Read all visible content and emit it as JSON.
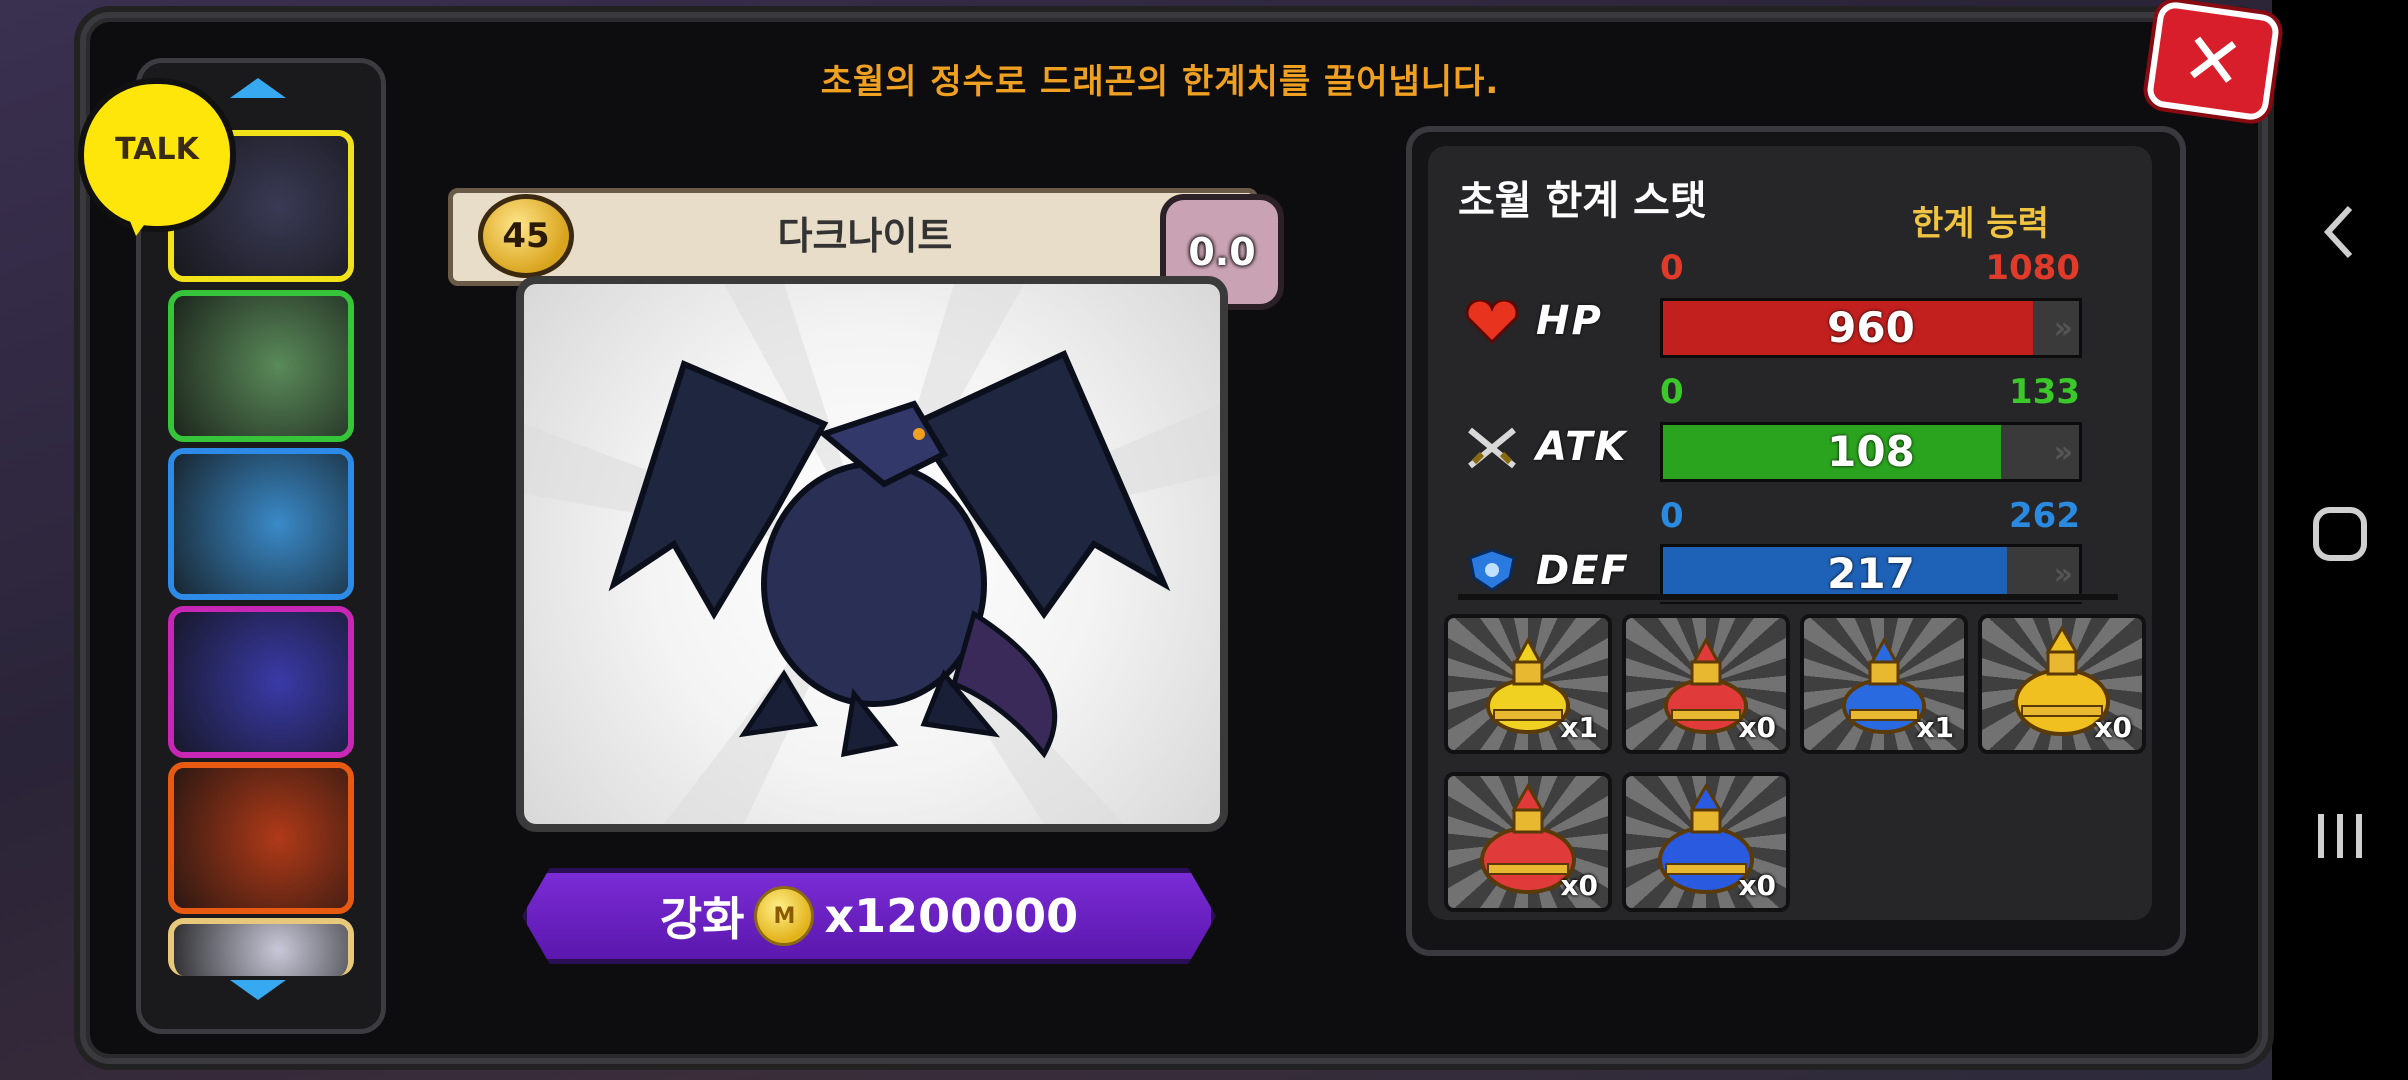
{
  "header": {
    "headline": "초월의 정수로 드래곤의 한계치를 끌어냅니다."
  },
  "close_icon": "close-icon",
  "talk_badge": {
    "label": "TALK"
  },
  "dragon_list": {
    "items": [
      {
        "name": "dark-dragon",
        "border": "#f2e21a",
        "bg": "#3a3a55"
      },
      {
        "name": "pink-dragon",
        "border": "#35c43a",
        "bg": "#5a8a5a"
      },
      {
        "name": "ice-dragon",
        "border": "#2d8ae6",
        "bg": "#3a8ac8"
      },
      {
        "name": "blue-red-dragon",
        "border": "#c826b4",
        "bg": "#3a3aa8"
      },
      {
        "name": "fire-dragon",
        "border": "#e85a12",
        "bg": "#b03a18"
      },
      {
        "name": "white-dragon",
        "border": "#e8c87a",
        "bg": "#c8c8d8"
      }
    ]
  },
  "card": {
    "level": "45",
    "name": "다크나이트",
    "star": "0.0"
  },
  "upgrade": {
    "label": "강화",
    "coin": "M",
    "cost": "x1200000"
  },
  "stats_panel": {
    "title": "초월 한계 스탯",
    "limit_label": "한계 능력",
    "stats": [
      {
        "name": "HP",
        "min": "0",
        "max": "1080",
        "value": "960",
        "fraction": 0.889,
        "color": "#c2201e",
        "label_color": "#e03a2a"
      },
      {
        "name": "ATK",
        "min": "0",
        "max": "133",
        "value": "108",
        "fraction": 0.812,
        "color": "#2aa41e",
        "label_color": "#3ac82a"
      },
      {
        "name": "DEF",
        "min": "0",
        "max": "262",
        "value": "217",
        "fraction": 0.828,
        "color": "#1e62b8",
        "label_color": "#2a8ae0"
      }
    ]
  },
  "potions": [
    {
      "name": "yellow-small-potion",
      "count": "x1",
      "color": "#f0d020"
    },
    {
      "name": "red-small-potion",
      "count": "x0",
      "color": "#e03a3a"
    },
    {
      "name": "blue-small-potion",
      "count": "x1",
      "color": "#2a6ae0"
    },
    {
      "name": "yellow-large-potion",
      "count": "x0",
      "color": "#f0c020"
    },
    {
      "name": "red-large-potion",
      "count": "x0",
      "color": "#e03a3a"
    },
    {
      "name": "blue-large-potion",
      "count": "x0",
      "color": "#2a5ae0"
    }
  ]
}
